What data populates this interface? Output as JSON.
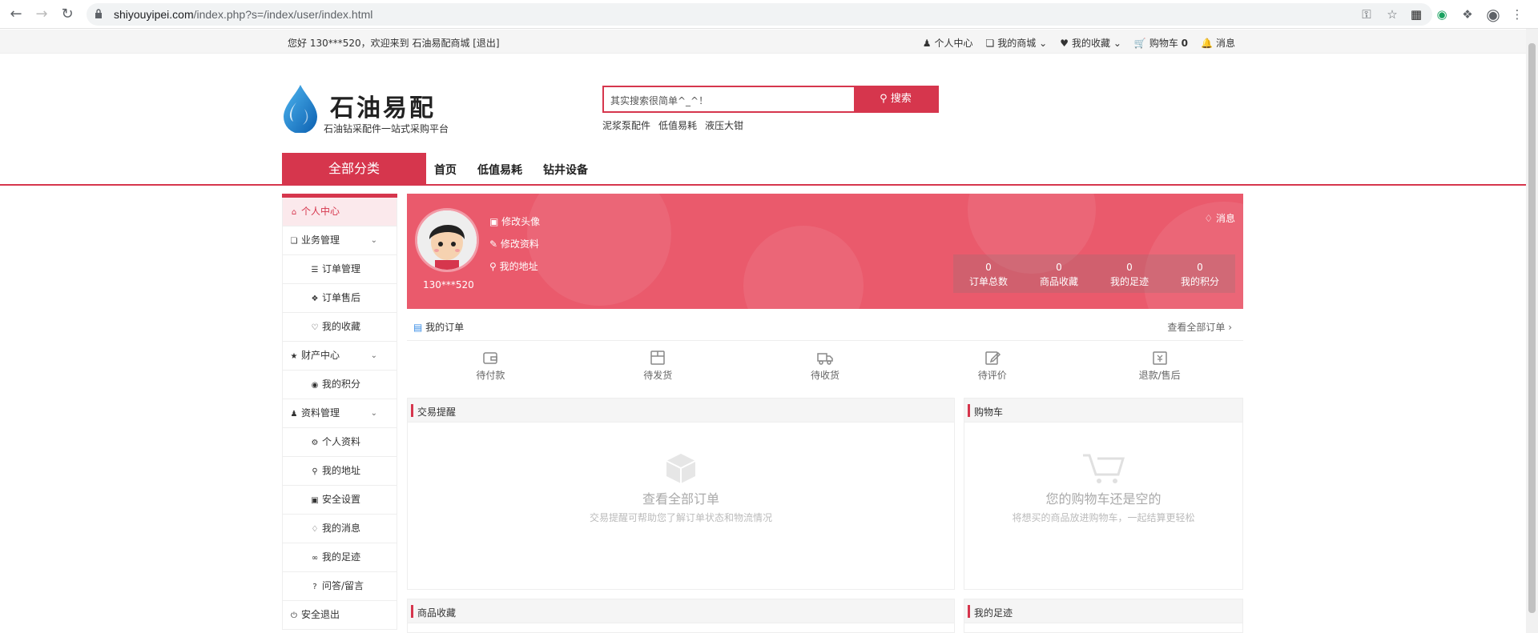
{
  "browser": {
    "url_host": "shiyouyipei.com",
    "url_path": "/index.php?s=/index/user/index.html"
  },
  "topbar": {
    "greeting": "您好 130***520，欢迎来到 石油易配商城 [退出]",
    "links": [
      {
        "label": "个人中心",
        "icon": "user-icon"
      },
      {
        "label": "我的商城",
        "icon": "cube-icon",
        "dropdown": true
      },
      {
        "label": "我的收藏",
        "icon": "heart-icon",
        "dropdown": true
      },
      {
        "label": "购物车",
        "icon": "cart-icon",
        "count": "0"
      },
      {
        "label": "消息",
        "icon": "bell-icon"
      }
    ]
  },
  "header": {
    "logo_name": "石油易配",
    "logo_tagline": "石油钻采配件一站式采购平台",
    "search_placeholder": "其实搜索很简单^_^！",
    "search_button": "搜索",
    "hot_words": [
      "泥浆泵配件",
      "低值易耗",
      "液压大钳"
    ]
  },
  "nav": {
    "all_categories": "全部分类",
    "links": [
      "首页",
      "低值易耗",
      "钻井设备"
    ]
  },
  "sidebar": {
    "items": [
      {
        "label": "个人中心",
        "icon": "home-icon",
        "active": true,
        "type": "top"
      },
      {
        "label": "业务管理",
        "icon": "cube-icon",
        "type": "group"
      },
      {
        "label": "订单管理",
        "icon": "list-icon",
        "type": "sub"
      },
      {
        "label": "订单售后",
        "icon": "puzzle-icon",
        "type": "sub"
      },
      {
        "label": "我的收藏",
        "icon": "heart-icon",
        "type": "sub"
      },
      {
        "label": "财产中心",
        "icon": "trophy-icon",
        "type": "group"
      },
      {
        "label": "我的积分",
        "icon": "coin-icon",
        "type": "sub"
      },
      {
        "label": "资料管理",
        "icon": "user-icon",
        "type": "group"
      },
      {
        "label": "个人资料",
        "icon": "gear-icon",
        "type": "sub"
      },
      {
        "label": "我的地址",
        "icon": "pin-icon",
        "type": "sub"
      },
      {
        "label": "安全设置",
        "icon": "lock-icon",
        "type": "sub"
      },
      {
        "label": "我的消息",
        "icon": "bell-icon",
        "type": "sub"
      },
      {
        "label": "我的足迹",
        "icon": "glasses-icon",
        "type": "sub"
      },
      {
        "label": "问答/留言",
        "icon": "question-icon",
        "type": "sub"
      },
      {
        "label": "安全退出",
        "icon": "power-icon",
        "type": "top"
      }
    ]
  },
  "banner": {
    "username": "130***520",
    "links": [
      "修改头像",
      "修改资料",
      "我的地址"
    ],
    "message": "消息",
    "stats": [
      {
        "value": "0",
        "label": "订单总数"
      },
      {
        "value": "0",
        "label": "商品收藏"
      },
      {
        "value": "0",
        "label": "我的足迹"
      },
      {
        "value": "0",
        "label": "我的积分"
      }
    ]
  },
  "orders": {
    "title": "我的订单",
    "view_all": "查看全部订单",
    "statuses": [
      {
        "label": "待付款",
        "icon": "wallet-icon"
      },
      {
        "label": "待发货",
        "icon": "box-icon"
      },
      {
        "label": "待收货",
        "icon": "truck-icon"
      },
      {
        "label": "待评价",
        "icon": "edit-icon"
      },
      {
        "label": "退款/售后",
        "icon": "refund-icon"
      }
    ]
  },
  "cards": {
    "trade": {
      "title": "交易提醒",
      "empty_title": "查看全部订单",
      "empty_desc": "交易提醒可帮助您了解订单状态和物流情况"
    },
    "cart": {
      "title": "购物车",
      "empty_title": "您的购物车还是空的",
      "empty_desc": "将想买的商品放进购物车，一起结算更轻松"
    },
    "favorites": {
      "title": "商品收藏"
    },
    "footprint": {
      "title": "我的足迹"
    }
  },
  "colors": {
    "accent": "#d6364d",
    "banner": "#ea5a6c"
  }
}
